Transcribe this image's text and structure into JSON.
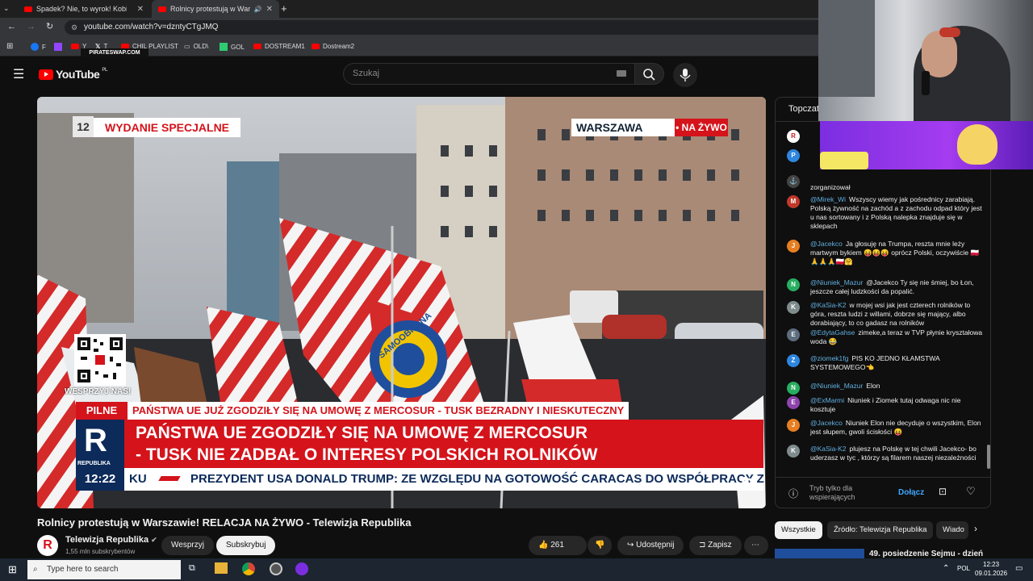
{
  "browser": {
    "tabs": [
      {
        "title": "Spadek? Nie, to wyrok! Kobieta",
        "active": false
      },
      {
        "title": "Rolnicy protestują w Warsz",
        "active": true
      }
    ],
    "url": "youtube.com/watch?v=dzntyCTgJMQ",
    "bookmarks": [
      "F",
      "Y",
      "T",
      "CHIL PLAYLIST",
      "OLD\\",
      "GOL",
      "DOSTREAM1",
      "Dostream2"
    ]
  },
  "youtube": {
    "logo": "YouTube",
    "region": "PL",
    "search_placeholder": "Szukaj"
  },
  "video": {
    "bug_number": "12",
    "special_label": "WYDANIE SPECJALNE",
    "city": "WARSZAWA",
    "live_label": "• NA ŻYWO",
    "qr_caption": "WESPRZYJ NAS!",
    "pilne_label": "PILNE",
    "pilne_text": "PAŃSTWA UE JUŻ ZGODZIŁY SIĘ NA UMOWĘ Z MERCOSUR - TUSK BEZRADNY I NIESKUTECZNY",
    "headline_1": "PAŃSTWA UE ZGODZIŁY SIĘ NA UMOWĘ Z MERCOSUR",
    "headline_2": "- TUSK NIE ZADBAŁ O INTERESY POLSKICH ROLNIKÓW",
    "channel_logo": "R",
    "channel_logo_caption": "REPUBLIKA",
    "time": "12:22",
    "ticker_prefix": "KU",
    "ticker_text": "PREZYDENT USA DONALD TRUMP: ZE WZGLĘDU NA GOTOWOŚĆ CARACAS DO WSPÓŁPRACY Z",
    "flag_text": "SAMOOBRONA"
  },
  "below": {
    "title": "Rolnicy protestują w Warszawie! RELACJA NA ŻYWO - Telewizja Republika",
    "channel_name": "Telewizja Republika",
    "subscribers": "1,55 mln subskrybentów",
    "support_label": "Wesprzyj",
    "subscribe_label": "Subskrybuj",
    "likes": "261 tys.",
    "share_label": "Udostępnij",
    "save_label": "Zapisz"
  },
  "chat": {
    "header": "Topczat",
    "messages": [
      {
        "author": "@Mirek_Wi",
        "text": "Wszyscy wiemy jak pośrednicy zarabiają. Polską żywność na zachód a z zachodu odpad który jest u nas sortowany i z Polską nalepka znajduje się w sklepach",
        "color": "#c0392b"
      },
      {
        "author": "@Jacekco",
        "text": "Ja głosuję na Trumpa, reszta mnie leży martwym bykiem 😝😝😝 oprócz Polski, oczywiście 🇵🇱🙏🙏🙏🇵🇱🤗",
        "color": "#e67e22"
      },
      {
        "author": "@Niuniek_Mazur",
        "text": "@Jacekco Ty się nie śmiej, bo Łon, jeszcze całej ludzkości da popalić.",
        "color": "#27ae60"
      },
      {
        "author": "@KaSia-K2",
        "text": "w mojej wsi jak jest czterech rolników to góra, reszta ludzi z willami, dobrze się mający, albo dorabiający, to co gadasz na rolników",
        "color": "#7f8c8d"
      },
      {
        "author": "@EdytaGahse",
        "text": "zimeke,a teraz w TVP płynie kryształowa woda 😂",
        "color": "#5d6d7e"
      },
      {
        "author": "@ziomek1fg",
        "text": "PIS KO JEDNO KŁAMSTWA SYSTEMOWEGO👈",
        "color": "#2e86de"
      },
      {
        "author": "@Niuniek_Mazur",
        "text": "Elon",
        "color": "#27ae60"
      },
      {
        "author": "@ExMarmi",
        "text": "Niuniek i Ziomek tutaj odwaga nic nie kosztuje",
        "color": "#8e44ad"
      },
      {
        "author": "@Jacekco",
        "text": "Niuniek Elon nie decyduje o wszystkim, Elon jest słupem, gwoli ścisłości 😝",
        "color": "#e67e22"
      },
      {
        "author": "@KaSia-K2",
        "text": "plujesz na Polskę w tej chwili Jacekco- bo uderzasz w tyc , którzy są filarem naszej niezależności",
        "color": "#7f8c8d"
      }
    ],
    "partial_top": "zorganizował",
    "footer_text_1": "Tryb tylko dla",
    "footer_text_2": "wspierających",
    "join_label": "Dołącz"
  },
  "chips": [
    "Wszystkie",
    "Źródło: Telewizja Republika",
    "Wiado"
  ],
  "recommended_title": "49. posiedzenie Sejmu - dzień",
  "overlay": {
    "banner_caption": "PIRATESWAP.COM"
  },
  "taskbar": {
    "search_placeholder": "Type here to search",
    "lang": "POL",
    "time": "12:23",
    "date": "09.01.2026"
  }
}
